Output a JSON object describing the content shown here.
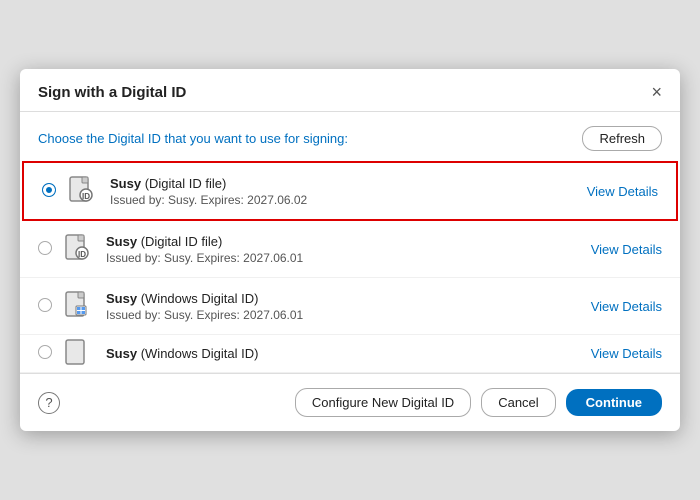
{
  "dialog": {
    "title": "Sign with a Digital ID",
    "close_label": "×",
    "subtitle": "Choose the Digital ID that you want to use for signing:",
    "refresh_label": "Refresh"
  },
  "id_items": [
    {
      "id": "item1",
      "selected": true,
      "name": "Susy",
      "type": "(Digital ID file)",
      "issued": "Issued by: Susy. Expires: 2027.06.02",
      "view_details": "View Details",
      "icon_type": "file"
    },
    {
      "id": "item2",
      "selected": false,
      "name": "Susy",
      "type": "(Digital ID file)",
      "issued": "Issued by: Susy. Expires: 2027.06.01",
      "view_details": "View Details",
      "icon_type": "file"
    },
    {
      "id": "item3",
      "selected": false,
      "name": "Susy",
      "type": "(Windows Digital ID)",
      "issued": "Issued by: Susy. Expires: 2027.06.01",
      "view_details": "View Details",
      "icon_type": "windows"
    }
  ],
  "partial_item": {
    "name": "Susy",
    "type": "(Windows Digital ID)",
    "view_details": "View Details"
  },
  "footer": {
    "help_icon": "?",
    "configure_label": "Configure New Digital ID",
    "cancel_label": "Cancel",
    "continue_label": "Continue"
  }
}
